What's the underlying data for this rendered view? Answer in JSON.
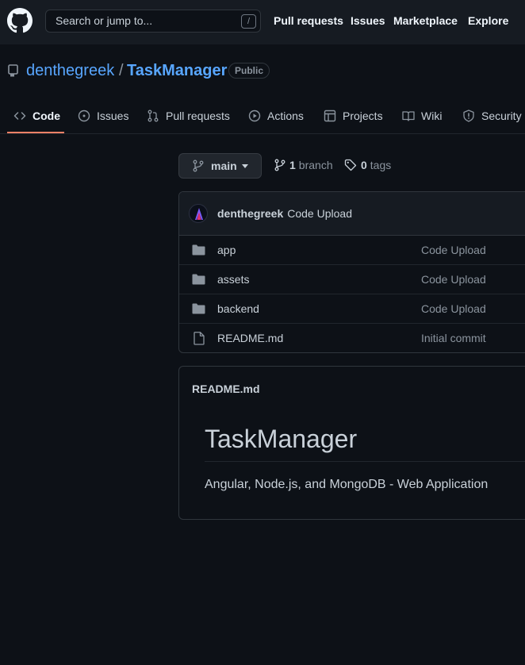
{
  "header": {
    "search_placeholder": "Search or jump to...",
    "search_shortcut": "/",
    "nav": [
      "Pull requests",
      "Issues",
      "Marketplace",
      "Explore"
    ]
  },
  "repo": {
    "owner": "denthegreek",
    "separator": "/",
    "name": "TaskManager",
    "visibility": "Public"
  },
  "tabs": [
    {
      "label": "Code",
      "icon": "code-icon",
      "active": true
    },
    {
      "label": "Issues",
      "icon": "issue-icon"
    },
    {
      "label": "Pull requests",
      "icon": "pull-request-icon"
    },
    {
      "label": "Actions",
      "icon": "play-icon"
    },
    {
      "label": "Projects",
      "icon": "table-icon"
    },
    {
      "label": "Wiki",
      "icon": "book-icon"
    },
    {
      "label": "Security",
      "icon": "shield-icon"
    }
  ],
  "branch": {
    "current": "main",
    "branch_count": "1",
    "branch_label": "branch",
    "tag_count": "0",
    "tag_label": "tags"
  },
  "latest_commit": {
    "author": "denthegreek",
    "message": "Code Upload"
  },
  "files": [
    {
      "name": "app",
      "type": "folder",
      "commit": "Code Upload"
    },
    {
      "name": "assets",
      "type": "folder",
      "commit": "Code Upload"
    },
    {
      "name": "backend",
      "type": "folder",
      "commit": "Code Upload"
    },
    {
      "name": "README.md",
      "type": "file",
      "commit": "Initial commit"
    }
  ],
  "readme": {
    "filename": "README.md",
    "title": "TaskManager",
    "description": "Angular, Node.js, and MongoDB - Web Application"
  },
  "colors": {
    "background": "#0d1117",
    "header": "#161b22",
    "link": "#58a6ff",
    "active_tab_underline": "#f78166"
  }
}
